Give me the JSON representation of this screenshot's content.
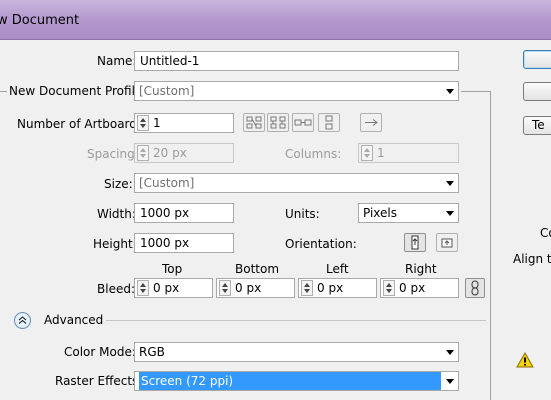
{
  "window": {
    "title": "w Document"
  },
  "form": {
    "name_label": "Name:",
    "name_value": "Untitled-1",
    "profile_label": "New Document Profile:",
    "profile_value": "[Custom]",
    "artboards_label": "Number of Artboards:",
    "artboards_value": "1",
    "spacing_label": "Spacing:",
    "spacing_value": "20 px",
    "columns_label": "Columns:",
    "columns_value": "1",
    "size_label": "Size:",
    "size_value": "[Custom]",
    "width_label": "Width:",
    "width_value": "1000 px",
    "units_label": "Units:",
    "units_value": "Pixels",
    "height_label": "Height:",
    "height_value": "1000 px",
    "orientation_label": "Orientation:",
    "orientation_selected": "portrait",
    "bleed_label": "Bleed:",
    "bleed": {
      "top_label": "Top",
      "top_value": "0 px",
      "bottom_label": "Bottom",
      "bottom_value": "0 px",
      "left_label": "Left",
      "left_value": "0 px",
      "right_label": "Right",
      "right_value": "0 px"
    }
  },
  "advanced": {
    "label": "Advanced",
    "color_mode_label": "Color Mode:",
    "color_mode_value": "RGB",
    "raster_label": "Raster Effects:",
    "raster_value": "Screen (72 ppi)"
  },
  "side": {
    "button3_label": "Te",
    "info_co": "Co",
    "info_align": "Align to"
  },
  "icons": {
    "artboard_layouts": [
      "grid-by-row-icon",
      "grid-by-column-icon",
      "arrange-by-row-icon",
      "arrange-by-column-icon",
      "right-to-left-icon"
    ],
    "orientation": [
      "portrait-icon",
      "landscape-icon"
    ],
    "link": "link-icon",
    "collapse": "chevron-up-double-icon",
    "warning": "warning-icon"
  },
  "colors": {
    "title_bar": "#b59bcf",
    "highlight": "#3399ff"
  }
}
